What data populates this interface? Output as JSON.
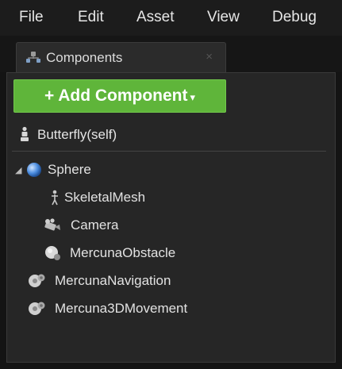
{
  "menu": {
    "file": "File",
    "edit": "Edit",
    "asset": "Asset",
    "view": "View",
    "debug": "Debug"
  },
  "tab": {
    "label": "Components",
    "close": "×"
  },
  "panel": {
    "add_button_plus": "+",
    "add_button_label": "Add Component",
    "add_button_caret": "▾",
    "self_label": "Butterfly(self)",
    "tree": [
      {
        "label": "Sphere",
        "icon": "sphere-icon",
        "expanded": true
      },
      {
        "label": "SkeletalMesh",
        "icon": "skeletal-mesh-icon"
      },
      {
        "label": "Camera",
        "icon": "camera-icon"
      },
      {
        "label": "MercunaObstacle",
        "icon": "obstacle-icon"
      },
      {
        "label": "MercunaNavigation",
        "icon": "navigation-component-icon"
      },
      {
        "label": "Mercuna3DMovement",
        "icon": "movement-component-icon"
      }
    ]
  },
  "colors": {
    "add_button": "#5fb53a",
    "panel_bg": "#262626",
    "menubar_bg": "#1c1c1c"
  }
}
